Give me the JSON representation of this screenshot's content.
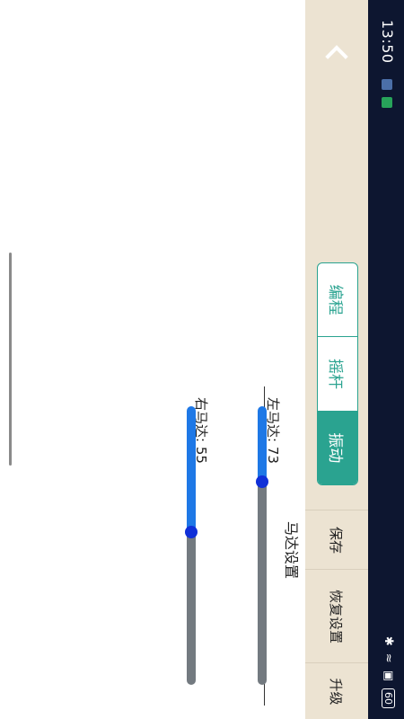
{
  "status": {
    "time": "13:50",
    "battery": "60"
  },
  "header": {
    "tabs": [
      {
        "label": "编程",
        "active": false
      },
      {
        "label": "摇杆",
        "active": false
      },
      {
        "label": "振动",
        "active": true
      }
    ],
    "save_label": "保存",
    "restore_label": "恢复设置",
    "upgrade_label": "升级"
  },
  "motor": {
    "section_title": "马达设置",
    "left_label": "左马达: 73",
    "left_value": 73,
    "right_label": "右马达: 55",
    "right_value": 55
  },
  "colors": {
    "accent": "#2aa390",
    "slider_fill": "#1e78e6",
    "slider_track": "#737a80",
    "thumb": "#1030d8"
  }
}
